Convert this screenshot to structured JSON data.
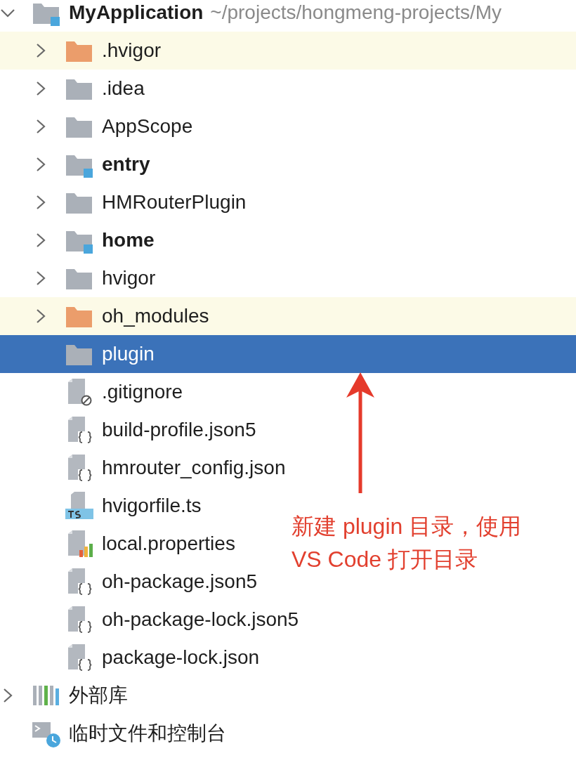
{
  "tree": [
    {
      "name": "MyApplication",
      "path": "~/projects/hongmeng-projects/My",
      "kind": "module",
      "expanded": true,
      "excluded": false,
      "selected": false,
      "children": [
        {
          "name": ".hvigor",
          "kind": "folder",
          "expanded": false,
          "excluded": true,
          "selected": false
        },
        {
          "name": ".idea",
          "kind": "folder",
          "expanded": false,
          "excluded": false,
          "selected": false
        },
        {
          "name": "AppScope",
          "kind": "folder",
          "expanded": false,
          "excluded": false,
          "selected": false
        },
        {
          "name": "entry",
          "kind": "module",
          "expanded": false,
          "excluded": false,
          "selected": false
        },
        {
          "name": "HMRouterPlugin",
          "kind": "folder",
          "expanded": false,
          "excluded": false,
          "selected": false
        },
        {
          "name": "home",
          "kind": "module",
          "expanded": false,
          "excluded": false,
          "selected": false
        },
        {
          "name": "hvigor",
          "kind": "folder",
          "expanded": false,
          "excluded": false,
          "selected": false
        },
        {
          "name": "oh_modules",
          "kind": "folder",
          "expanded": false,
          "excluded": true,
          "selected": false
        },
        {
          "name": "plugin",
          "kind": "folder",
          "excluded": false,
          "selected": true
        },
        {
          "name": ".gitignore",
          "kind": "ignore",
          "excluded": false,
          "selected": false
        },
        {
          "name": "build-profile.json5",
          "kind": "json",
          "excluded": false,
          "selected": false
        },
        {
          "name": "hmrouter_config.json",
          "kind": "json",
          "excluded": false,
          "selected": false
        },
        {
          "name": "hvigorfile.ts",
          "kind": "ts",
          "excluded": false,
          "selected": false
        },
        {
          "name": "local.properties",
          "kind": "properties",
          "excluded": false,
          "selected": false
        },
        {
          "name": "oh-package.json5",
          "kind": "json",
          "excluded": false,
          "selected": false
        },
        {
          "name": "oh-package-lock.json5",
          "kind": "json",
          "excluded": false,
          "selected": false
        },
        {
          "name": "package-lock.json",
          "kind": "json",
          "excluded": false,
          "selected": false
        }
      ]
    },
    {
      "name": "外部库",
      "kind": "libraries",
      "expanded": false,
      "excluded": false,
      "selected": false
    },
    {
      "name": "临时文件和控制台",
      "kind": "scratches",
      "excluded": false,
      "selected": false
    }
  ],
  "annotation": {
    "lines": [
      "新建 plugin 目录，使用",
      "VS Code 打开目录"
    ]
  }
}
